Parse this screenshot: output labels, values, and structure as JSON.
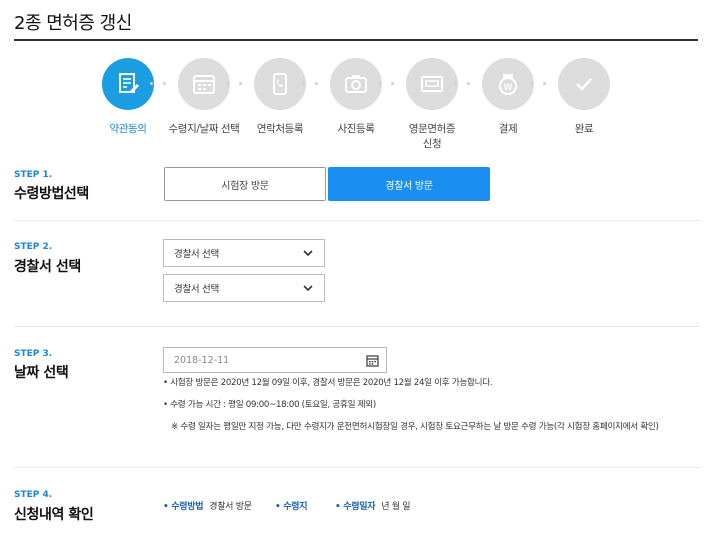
{
  "page": {
    "title": "2종 면허증 갱신"
  },
  "steps": [
    {
      "label": "약관동의",
      "icon": "document-edit-icon",
      "active": true
    },
    {
      "label": "수령지/날짜 선택",
      "icon": "calendar-icon",
      "active": false
    },
    {
      "label": "연락처등록",
      "icon": "phone-icon",
      "active": false
    },
    {
      "label": "사진등록",
      "icon": "camera-icon",
      "active": false
    },
    {
      "label": "영문면허증\n신청",
      "icon": "id-card-icon",
      "active": false
    },
    {
      "label": "결제",
      "icon": "payment-icon",
      "active": false
    },
    {
      "label": "완료",
      "icon": "check-icon",
      "active": false
    }
  ],
  "step1": {
    "tag": "STEP 1.",
    "heading": "수령방법선택",
    "option_exam": "시험장 방문",
    "option_police": "경찰서 방문",
    "selected": "경찰서 방문"
  },
  "step2": {
    "tag": "STEP 2.",
    "heading": "경찰서 선택",
    "select1": "경찰서 선택",
    "select2": "경찰서 선택"
  },
  "step3": {
    "tag": "STEP 3.",
    "heading": "날짜 선택",
    "date_placeholder": "2018-12-11",
    "note1": "• 시험장 방문은 2020년 12월 09일 이후, 경찰서 방문은 2020년 12월 24일 이후 가능합니다.",
    "note2": "• 수령 가능 시간 : 평일 09:00~18:00 (토요일, 공휴일 제외)",
    "note3": "※ 수령 일자는 평일만 지정 가능, 다만 수령지가 운전면허시험장일 경우, 시험장 토요근무하는 날 방문 수령 가능(각 시험장 홈페이지에서 확인)"
  },
  "step4": {
    "tag": "STEP 4.",
    "heading": "신청내역 확인",
    "method_key": "• 수령방법",
    "method_value": "경찰서 방문",
    "place_key": "• 수령지",
    "place_value": "",
    "date_key": "• 수령일자",
    "date_value": "년 월 일"
  },
  "colors": {
    "accent": "#1b9de2",
    "button_active": "#1b8ef2",
    "inactive_circle": "#dcdcdc"
  }
}
